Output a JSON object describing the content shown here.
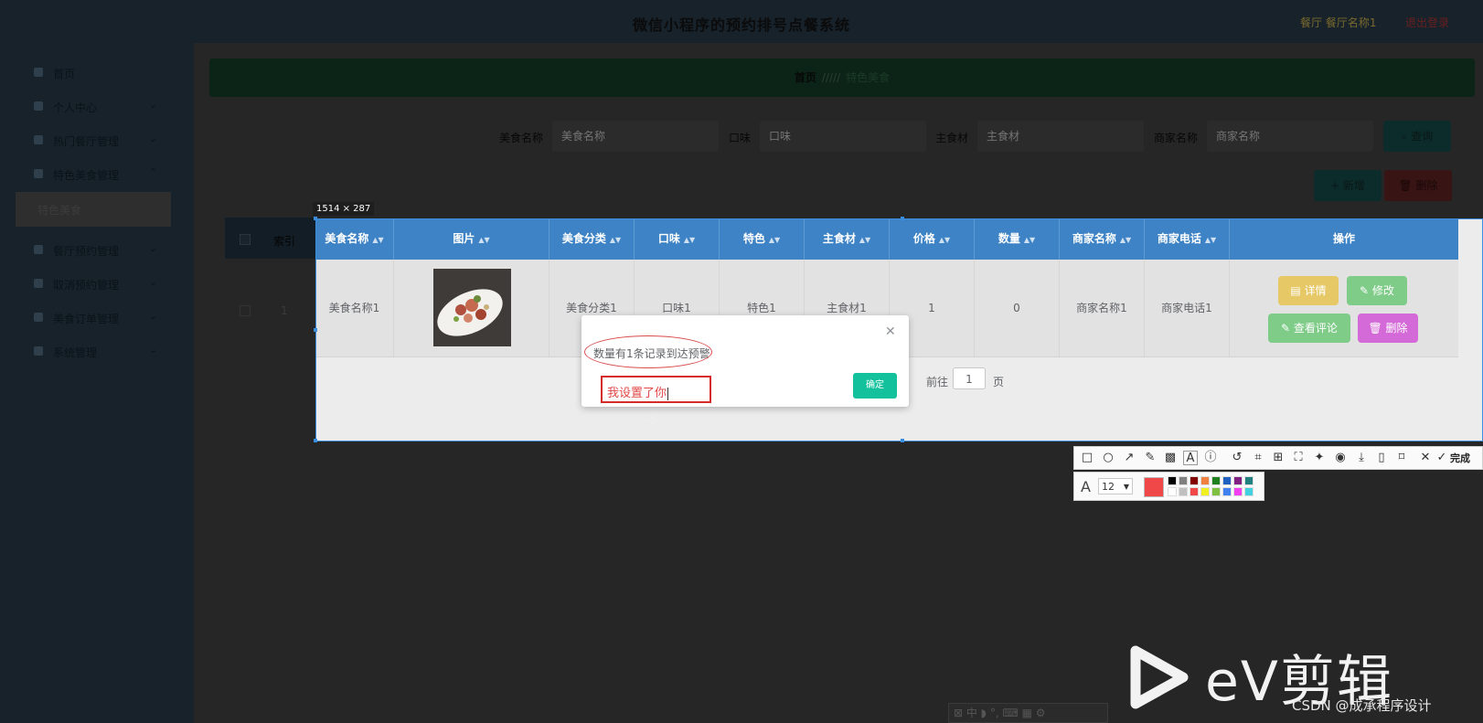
{
  "header": {
    "title": "微信小程序的预约排号点餐系统",
    "user": "餐厅 餐厅名称1",
    "logout": "退出登录"
  },
  "sidebar": {
    "items": [
      {
        "label": "首页"
      },
      {
        "label": "个人中心"
      },
      {
        "label": "热门餐厅管理"
      },
      {
        "label": "特色美食管理"
      },
      {
        "label": "餐厅预约管理"
      },
      {
        "label": "取消预约管理"
      },
      {
        "label": "美食订单管理"
      },
      {
        "label": "系统管理"
      }
    ],
    "sub_item": "特色美食"
  },
  "breadcrumb": {
    "home": "首页",
    "sep": "/////",
    "current": "特色美食"
  },
  "search": {
    "fields": [
      {
        "label": "美食名称",
        "placeholder": "美食名称"
      },
      {
        "label": "口味",
        "placeholder": "口味"
      },
      {
        "label": "主食材",
        "placeholder": "主食材"
      },
      {
        "label": "商家名称",
        "placeholder": "商家名称"
      }
    ],
    "query_button": "查询",
    "add_button": "+ 新增",
    "batch_delete_button": "删除"
  },
  "selection": {
    "size_label": "1514 × 287"
  },
  "table": {
    "index_header": "索引",
    "columns": [
      "美食名称",
      "图片",
      "美食分类",
      "口味",
      "特色",
      "主食材",
      "价格",
      "数量",
      "商家名称",
      "商家电话",
      "操作"
    ],
    "rows": [
      {
        "index": "1",
        "name": "美食名称1",
        "category": "美食分类1",
        "taste": "口味1",
        "feature": "特色1",
        "ingredient": "主食材1",
        "price": "1",
        "quantity": "0",
        "merchant": "商家名称1",
        "phone": "商家电话1"
      }
    ],
    "actions": {
      "detail": "详情",
      "edit": "修改",
      "review": "查看评论",
      "delete": "删除"
    }
  },
  "pagination": {
    "goto": "前往",
    "page": "1",
    "page_suffix": "页"
  },
  "dialog": {
    "message": "数量有1条记录到达预警",
    "ok": "确定",
    "annotation_text": "我设置了你"
  },
  "toolbar": {
    "done": "完成",
    "font_size": "12"
  },
  "colors": {
    "header_blue": "#3d83c6",
    "ok_green": "#13c29c",
    "annotation_red": "#e24848",
    "current_color": "#f04848",
    "swatches_top": [
      "#000000",
      "#808080",
      "#800000",
      "#f08040",
      "#208020",
      "#2060c0",
      "#802080",
      "#208080"
    ],
    "swatches_bottom": [
      "#ffffff",
      "#c0c0c0",
      "#f04848",
      "#f0f020",
      "#80c040",
      "#4080f0",
      "#f040f0",
      "#40d0e0"
    ]
  },
  "watermark": {
    "brand": "eV剪辑",
    "credit": "CSDN @成承程序设计"
  }
}
